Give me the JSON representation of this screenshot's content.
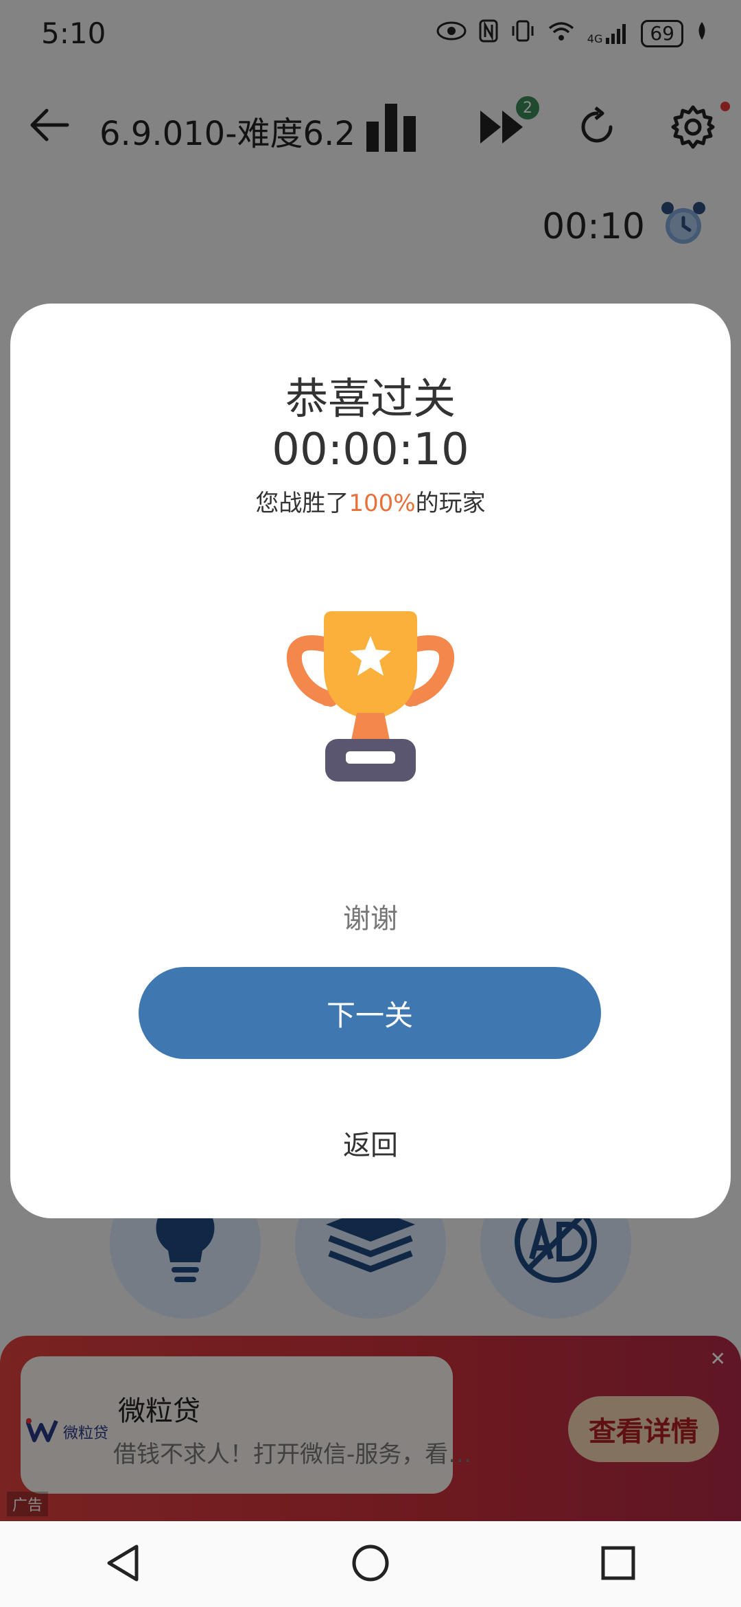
{
  "status_bar": {
    "time": "5:10",
    "network": "4G",
    "battery": "69"
  },
  "toolbar": {
    "title": "6.9.010-难度6.2",
    "skip_badge": "2"
  },
  "game": {
    "timer": "00:10"
  },
  "modal": {
    "title": "恭喜过关",
    "time": "00:00:10",
    "subtitle_prefix": "您战胜了",
    "subtitle_percent": "100%",
    "subtitle_suffix": "的玩家",
    "thanks_label": "谢谢",
    "next_label": "下一关",
    "back_label": "返回"
  },
  "ad": {
    "logo_text": "微粒贷",
    "title": "微粒贷",
    "description": "借钱不求人！打开微信-服务，看…",
    "cta": "查看详情",
    "tag": "广告"
  },
  "colors": {
    "primary": "#3f78b0",
    "accent": "#e8703a",
    "ad_red": "#c9303a"
  }
}
